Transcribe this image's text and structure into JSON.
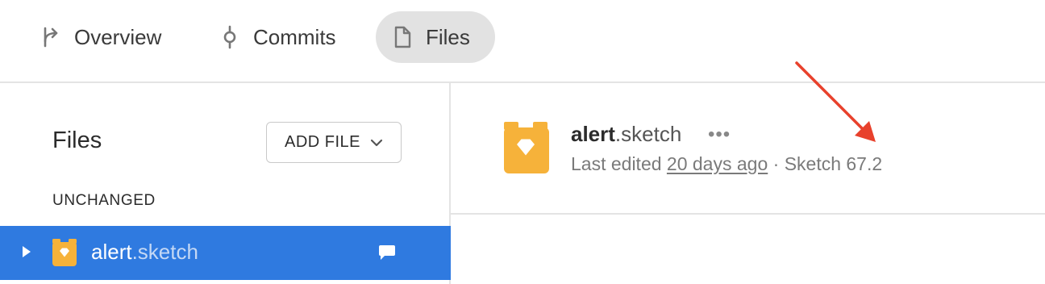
{
  "tabs": [
    {
      "label": "Overview",
      "icon": "branch-merge-icon",
      "active": false
    },
    {
      "label": "Commits",
      "icon": "commit-icon",
      "active": false
    },
    {
      "label": "Files",
      "icon": "file-icon",
      "active": true
    }
  ],
  "sidebar": {
    "title": "Files",
    "add_file_label": "ADD FILE",
    "section_label": "UNCHANGED",
    "files": [
      {
        "name_base": "alert",
        "name_ext": ".sketch",
        "selected": true
      }
    ]
  },
  "main": {
    "file_base": "alert",
    "file_ext": ".sketch",
    "more_label": "•••",
    "meta_prefix": "Last edited ",
    "meta_time": "20 days ago",
    "meta_suffix": " · Sketch 67.2"
  },
  "colors": {
    "selection": "#2f7ae0",
    "sketch_icon": "#f6b23a",
    "arrow": "#e8412c",
    "active_tab": "#e2e2e2"
  }
}
